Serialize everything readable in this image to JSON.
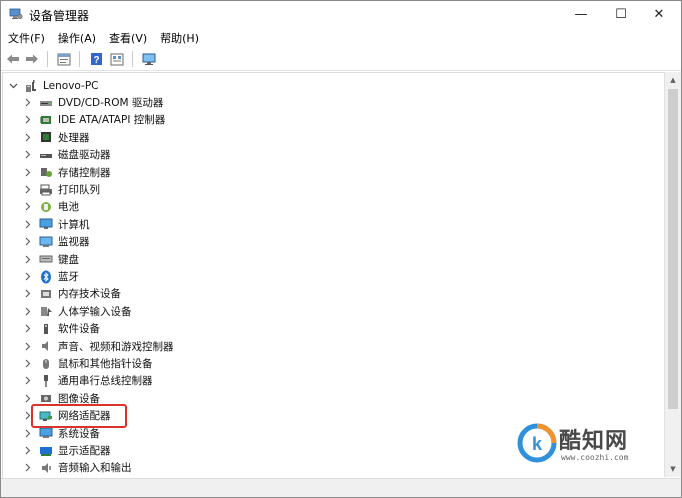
{
  "window": {
    "title": "设备管理器",
    "minimize_glyph": "—",
    "maximize_glyph": "☐",
    "close_glyph": "✕"
  },
  "menu": [
    "文件(F)",
    "操作(A)",
    "查看(V)",
    "帮助(H)"
  ],
  "toolbar": [
    "back-icon",
    "forward-icon",
    "properties-icon",
    "help-icon",
    "view-icon",
    "monitor-icon"
  ],
  "tree": {
    "root": {
      "label": "Lenovo-PC",
      "icon": "computer-icon",
      "expanded": true
    },
    "items": [
      {
        "label": "DVD/CD-ROM 驱动器",
        "icon": "dvd-drive-icon"
      },
      {
        "label": "IDE ATA/ATAPI 控制器",
        "icon": "ide-controller-icon"
      },
      {
        "label": "处理器",
        "icon": "processor-icon"
      },
      {
        "label": "磁盘驱动器",
        "icon": "disk-drive-icon"
      },
      {
        "label": "存储控制器",
        "icon": "storage-controller-icon"
      },
      {
        "label": "打印队列",
        "icon": "printer-icon"
      },
      {
        "label": "电池",
        "icon": "battery-icon"
      },
      {
        "label": "计算机",
        "icon": "computer-icon"
      },
      {
        "label": "监视器",
        "icon": "monitor-icon"
      },
      {
        "label": "键盘",
        "icon": "keyboard-icon"
      },
      {
        "label": "蓝牙",
        "icon": "bluetooth-icon"
      },
      {
        "label": "内存技术设备",
        "icon": "memory-icon"
      },
      {
        "label": "人体学输入设备",
        "icon": "hid-icon"
      },
      {
        "label": "软件设备",
        "icon": "software-device-icon"
      },
      {
        "label": "声音、视频和游戏控制器",
        "icon": "audio-icon"
      },
      {
        "label": "鼠标和其他指针设备",
        "icon": "mouse-icon"
      },
      {
        "label": "通用串行总线控制器",
        "icon": "usb-icon"
      },
      {
        "label": "图像设备",
        "icon": "camera-icon"
      },
      {
        "label": "网络适配器",
        "icon": "network-adapter-icon"
      },
      {
        "label": "系统设备",
        "icon": "system-device-icon"
      },
      {
        "label": "显示适配器",
        "icon": "display-adapter-icon"
      },
      {
        "label": "音频输入和输出",
        "icon": "audio-io-icon"
      }
    ],
    "highlighted_item": "网络适配器"
  },
  "watermark": {
    "title": "酷知网",
    "url": "www.coozhi.com"
  },
  "colors": {
    "highlight_border": "#d9342b",
    "accent_blue": "#1e88d8"
  }
}
